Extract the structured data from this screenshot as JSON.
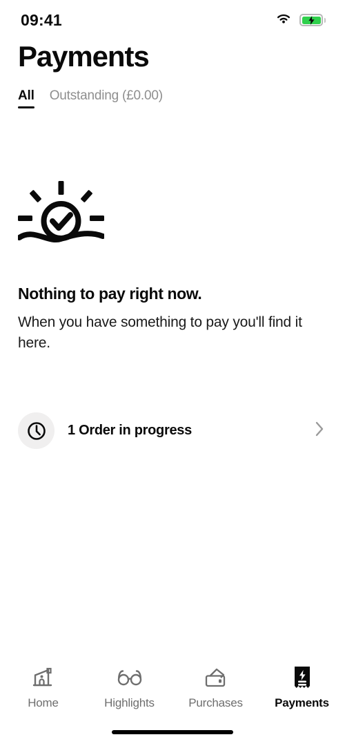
{
  "status_bar": {
    "time": "09:41",
    "wifi_icon": "wifi-icon",
    "battery_icon": "battery-charging-icon",
    "battery_color": "#2FD04C"
  },
  "header": {
    "title": "Payments",
    "tabs": [
      {
        "label": "All",
        "active": true
      },
      {
        "label": "Outstanding (£0.00)",
        "active": false
      }
    ]
  },
  "empty_state": {
    "icon": "sunrise-check-icon",
    "title": "Nothing to pay right now.",
    "body": "When you have something to pay you'll find it here."
  },
  "order_row": {
    "icon": "clock-icon",
    "label": "1 Order in progress",
    "chevron_icon": "chevron-right-icon"
  },
  "bottom_nav": {
    "items": [
      {
        "label": "Home",
        "icon": "house-icon",
        "active": false
      },
      {
        "label": "Highlights",
        "icon": "glasses-icon",
        "active": false
      },
      {
        "label": "Purchases",
        "icon": "wallet-icon",
        "active": false
      },
      {
        "label": "Payments",
        "icon": "receipt-bolt-icon",
        "active": true
      }
    ]
  },
  "colors": {
    "text_primary": "#0A0A0A",
    "text_muted": "#8E8E8E",
    "icon_circle_bg": "#F0EFEF",
    "accent": "#000000"
  }
}
